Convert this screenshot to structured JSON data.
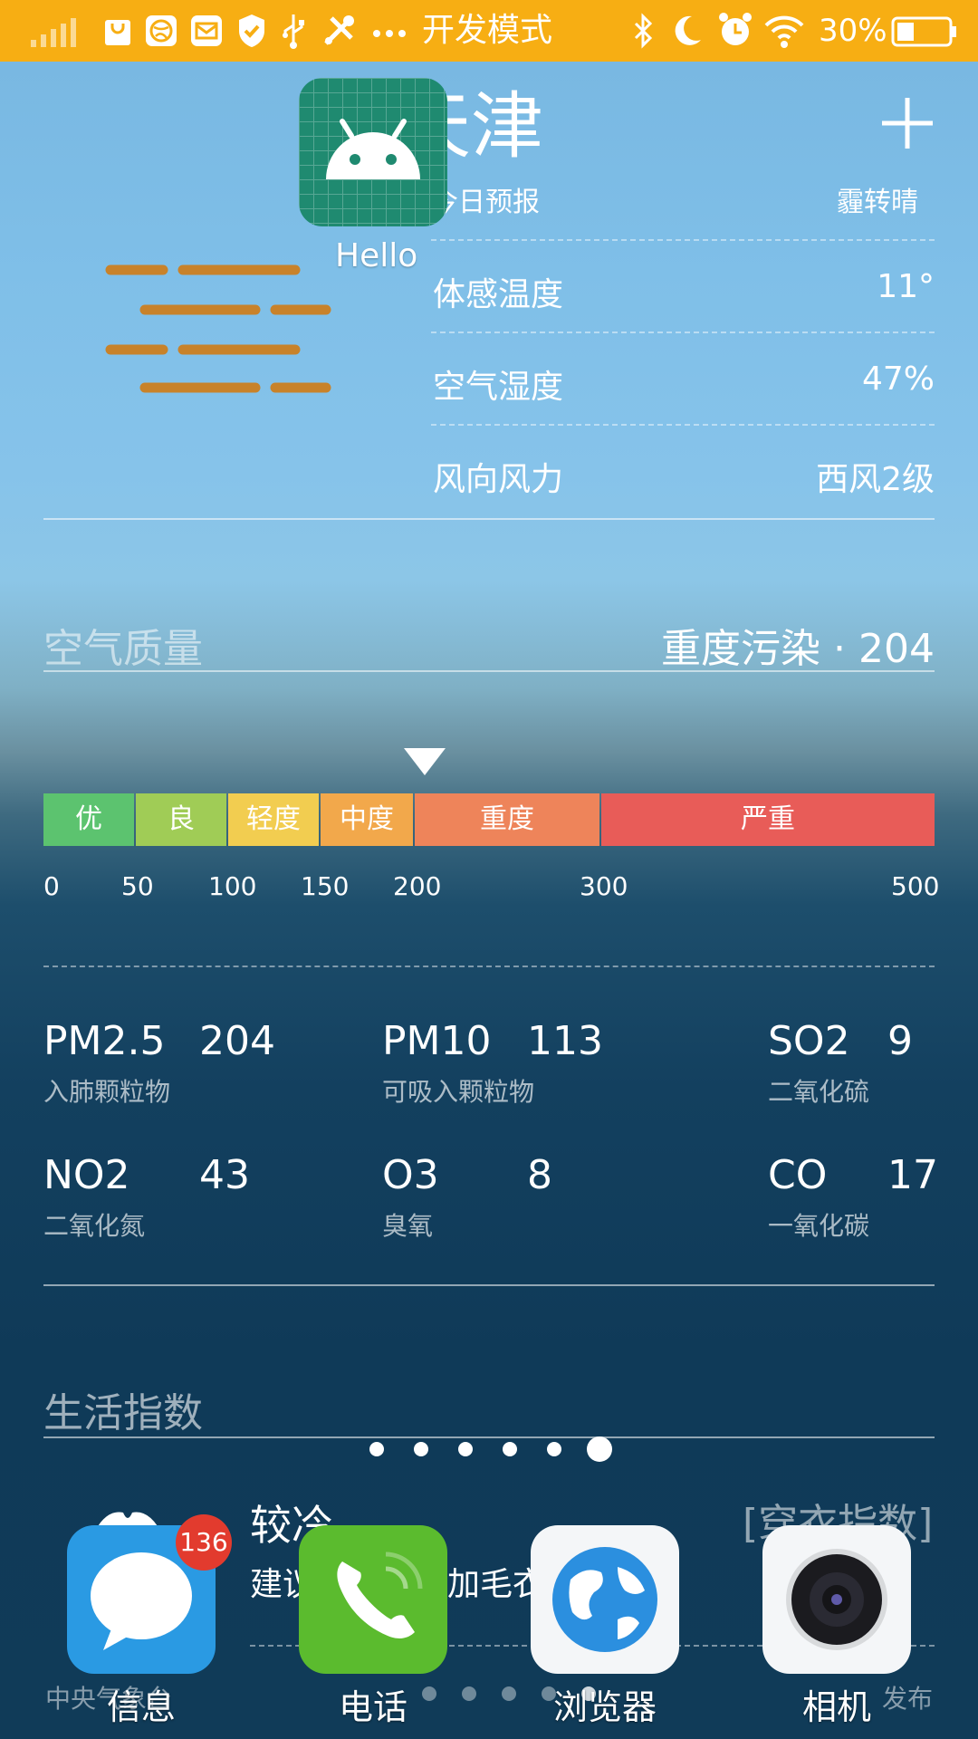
{
  "status_bar": {
    "mode_text": "开发模式",
    "battery": "30%",
    "icons": [
      "signal-icon",
      "bag-icon",
      "globe-icon",
      "mail-icon",
      "shield-icon",
      "usb-icon",
      "tools-icon",
      "more-icon",
      "bluetooth-icon",
      "moon-icon",
      "alarm-icon",
      "wifi-icon",
      "battery-icon"
    ],
    "bg_color": "#f7ae13"
  },
  "weather": {
    "city_visible": "天津",
    "forecast_label_visible": "今日预报",
    "weather_text_visible": "霾转晴",
    "add_label": "+",
    "details": [
      {
        "label": "体感温度",
        "value": "11°"
      },
      {
        "label": "空气湿度",
        "value": "47%"
      },
      {
        "label": "风向风力",
        "value": "西风2级"
      }
    ]
  },
  "overlay_app": {
    "label": "Hello",
    "color": "#1f8a70"
  },
  "air_quality": {
    "title": "空气质量",
    "summary": "重度污染 · 204",
    "segments": [
      {
        "label": "优",
        "color": "#5cc36f"
      },
      {
        "label": "良",
        "color": "#a0cc56"
      },
      {
        "label": "轻度",
        "color": "#f2cd50"
      },
      {
        "label": "中度",
        "color": "#f2a84b"
      },
      {
        "label": "重度",
        "color": "#ee845a"
      },
      {
        "label": "严重",
        "color": "#e85c58"
      }
    ],
    "ticks": [
      "0",
      "50",
      "100",
      "150",
      "200",
      "300",
      "500"
    ],
    "current_value": 204,
    "pollutants": [
      {
        "name": "PM2.5",
        "value": "204",
        "desc": "入肺颗粒物"
      },
      {
        "name": "PM10",
        "value": "113",
        "desc": "可吸入颗粒物"
      },
      {
        "name": "SO2",
        "value": "9",
        "desc": "二氧化硫"
      },
      {
        "name": "NO2",
        "value": "43",
        "desc": "二氧化氮"
      },
      {
        "name": "O3",
        "value": "8",
        "desc": "臭氧"
      },
      {
        "name": "CO",
        "value": "17",
        "desc": "一氧化碳"
      }
    ]
  },
  "life_index": {
    "title": "生活指数",
    "item_title": "较冷",
    "item_desc_visible_start": "建议",
    "item_desc_visible_end": "加毛衣",
    "item_type": "[穿衣指数]",
    "source_visible": "中央气象台",
    "publish_visible": "发布"
  },
  "page_indicator": {
    "count": 6,
    "active": 5
  },
  "dock": [
    {
      "label": "信息",
      "badge": "136",
      "icon": "message-icon"
    },
    {
      "label": "电话",
      "icon": "phone-icon"
    },
    {
      "label": "浏览器",
      "icon": "browser-icon"
    },
    {
      "label": "相机",
      "icon": "camera-icon"
    }
  ]
}
